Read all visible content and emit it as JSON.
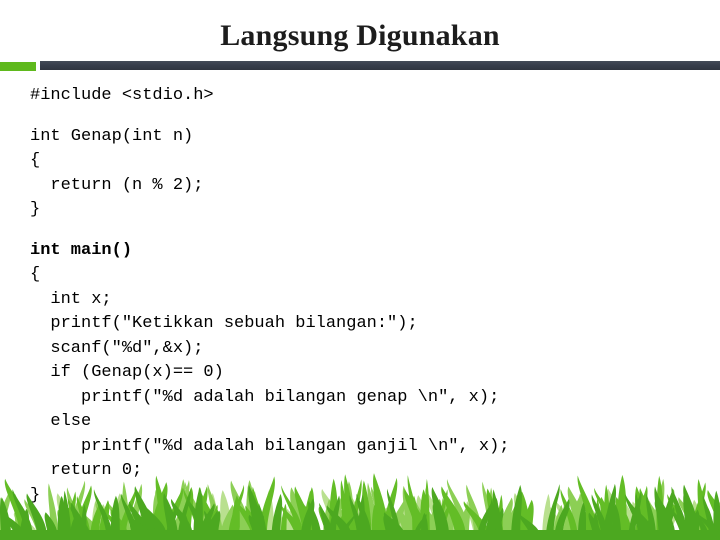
{
  "slide": {
    "title": "Langsung Digunakan",
    "background_color": "#ffffff",
    "title_color": "#1d1d1d"
  },
  "divider": {
    "accent_color": "#5fb91d",
    "bar_color": "#3a4250"
  },
  "code": {
    "language": "c",
    "lines": [
      {
        "text": "#include <stdio.h>",
        "bold": false,
        "blank": false
      },
      {
        "text": "",
        "bold": false,
        "blank": true
      },
      {
        "text": "int Genap(int n)",
        "bold": false,
        "blank": false
      },
      {
        "text": "{",
        "bold": false,
        "blank": false
      },
      {
        "text": "  return (n % 2);",
        "bold": false,
        "blank": false
      },
      {
        "text": "}",
        "bold": false,
        "blank": false
      },
      {
        "text": "",
        "bold": false,
        "blank": true
      },
      {
        "text": "int main()",
        "bold": true,
        "blank": false
      },
      {
        "text": "{",
        "bold": false,
        "blank": false
      },
      {
        "text": "  int x;",
        "bold": false,
        "blank": false
      },
      {
        "text": "  printf(\"Ketikkan sebuah bilangan:\");",
        "bold": false,
        "blank": false
      },
      {
        "text": "  scanf(\"%d\",&x);",
        "bold": false,
        "blank": false
      },
      {
        "text": "  if (Genap(x)== 0)",
        "bold": false,
        "blank": false
      },
      {
        "text": "     printf(\"%d adalah bilangan genap \\n\", x);",
        "bold": false,
        "blank": false
      },
      {
        "text": "  else",
        "bold": false,
        "blank": false
      },
      {
        "text": "     printf(\"%d adalah bilangan ganjil \\n\", x);",
        "bold": false,
        "blank": false
      },
      {
        "text": "  return 0;",
        "bold": false,
        "blank": false
      },
      {
        "text": "}",
        "bold": false,
        "blank": false
      }
    ]
  },
  "decoration": {
    "grass": {
      "name": "grass-illustration",
      "colors": {
        "dark": "#4ca820",
        "mid": "#63bd26",
        "light": "#8ccf55",
        "pale": "#b9e08f"
      }
    }
  }
}
